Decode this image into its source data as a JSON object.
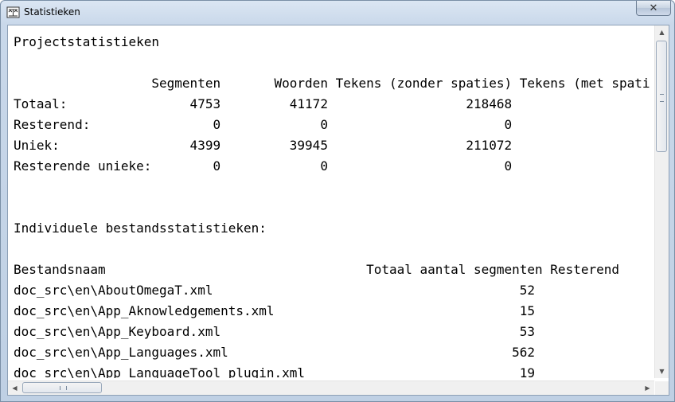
{
  "window": {
    "title": "Statistieken",
    "close_symbol": "✕"
  },
  "lines": [
    "Projectstatistieken",
    "",
    "                  Segmenten       Woorden Tekens (zonder spaties) Tekens (met spaties)",
    "Totaal:                4753         41172                  218468",
    "Resterend:                0             0                       0",
    "Uniek:                 4399         39945                  211072",
    "Resterende unieke:        0             0                       0",
    "",
    "",
    "Individuele bestandsstatistieken:",
    "",
    "Bestandsnaam                                  Totaal aantal segmenten Resterend",
    "doc_src\\en\\AboutOmegaT.xml                                        52",
    "doc_src\\en\\App_Aknowledgements.xml                                15",
    "doc_src\\en\\App_Keyboard.xml                                       53",
    "doc_src\\en\\App_Languages.xml                                     562",
    "doc_src\\en\\App_LanguageTool_plugin.xml                            19"
  ],
  "scrollbar": {
    "up": "▲",
    "down": "▼",
    "left": "◀",
    "right": "▶"
  }
}
